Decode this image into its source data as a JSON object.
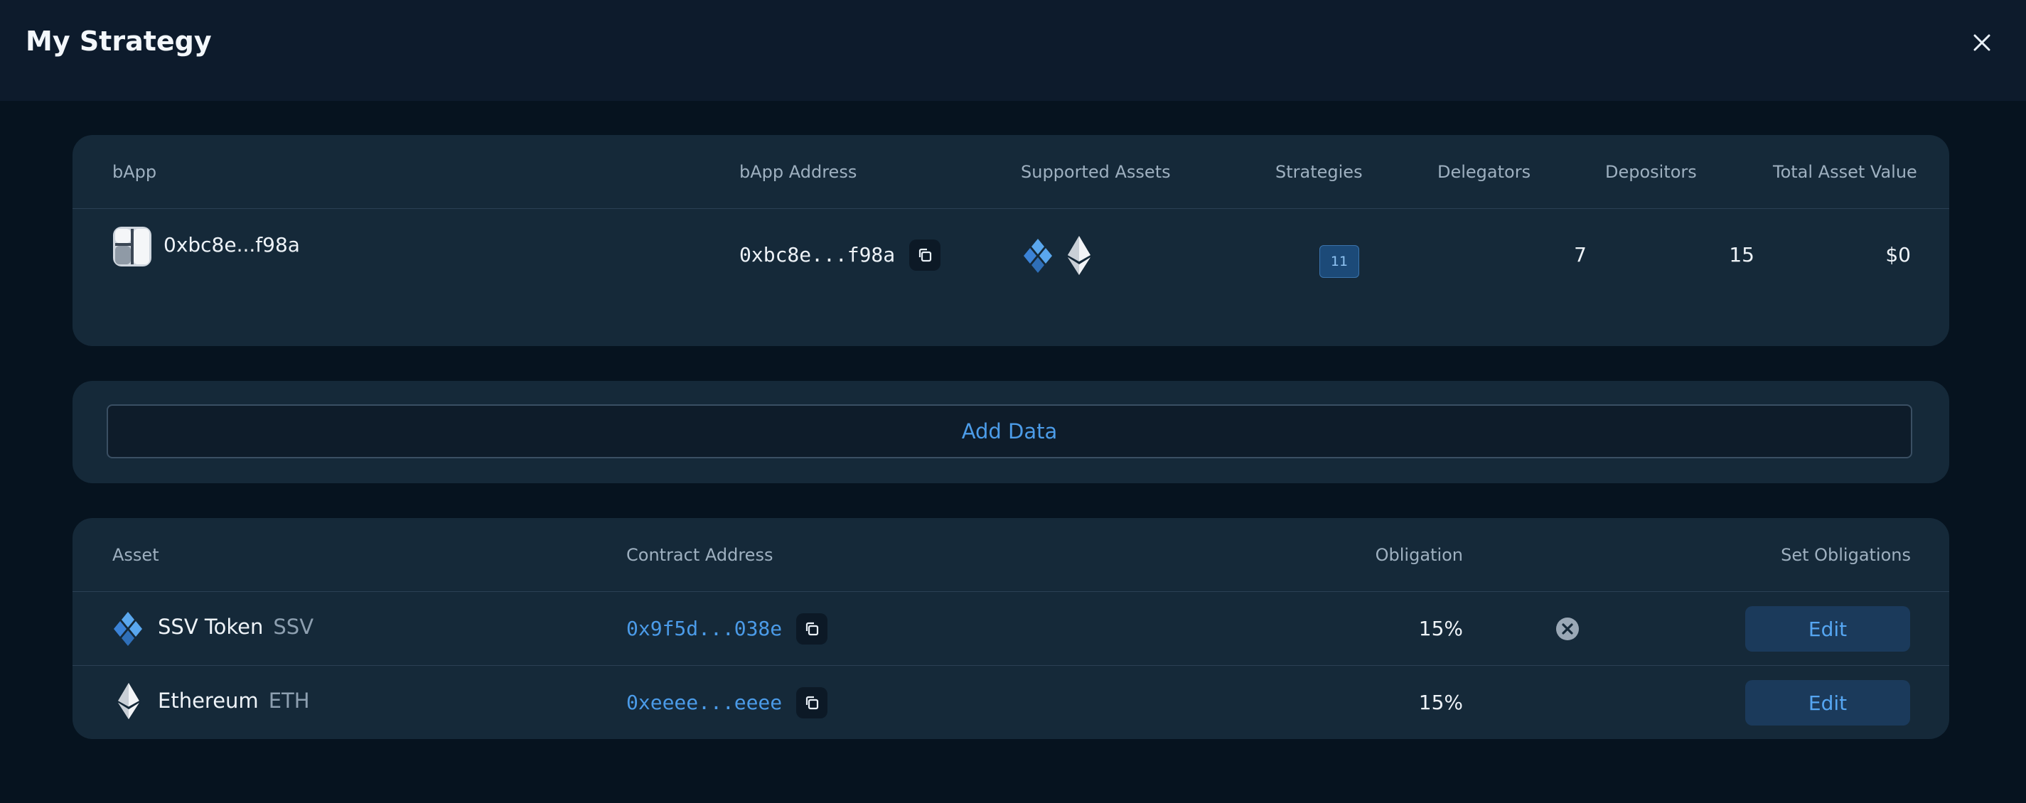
{
  "header": {
    "title": "My Strategy",
    "close_icon": "close-icon"
  },
  "bapp_table": {
    "columns": [
      "bApp",
      "bApp Address",
      "Supported Assets",
      "Strategies",
      "Delegators",
      "Depositors",
      "Total Asset Value"
    ],
    "row": {
      "bapp_name": "0xbc8e...f98a",
      "bapp_address": "0xbc8e...f98a",
      "supported_assets": [
        "ssv-token-icon",
        "ethereum-icon"
      ],
      "strategies": "11",
      "delegators": "7",
      "depositors": "15",
      "total_asset_value": "$0"
    }
  },
  "add_data": {
    "label": "Add Data"
  },
  "asset_table": {
    "columns": [
      "Asset",
      "Contract Address",
      "Obligation",
      "Set Obligations"
    ],
    "rows": [
      {
        "icon": "ssv-token-icon",
        "name": "SSV Token",
        "symbol": "SSV",
        "address": "0x9f5d...038e",
        "obligation": "15%",
        "edit_label": "Edit"
      },
      {
        "icon": "ethereum-icon",
        "name": "Ethereum",
        "symbol": "ETH",
        "address": "0xeeee...eeee",
        "obligation": "15%",
        "edit_label": "Edit"
      }
    ]
  },
  "colors": {
    "background": "#06131f",
    "card": "#152939",
    "accent_blue": "#4b9be8",
    "edit_button_bg": "#1b3a5b"
  }
}
